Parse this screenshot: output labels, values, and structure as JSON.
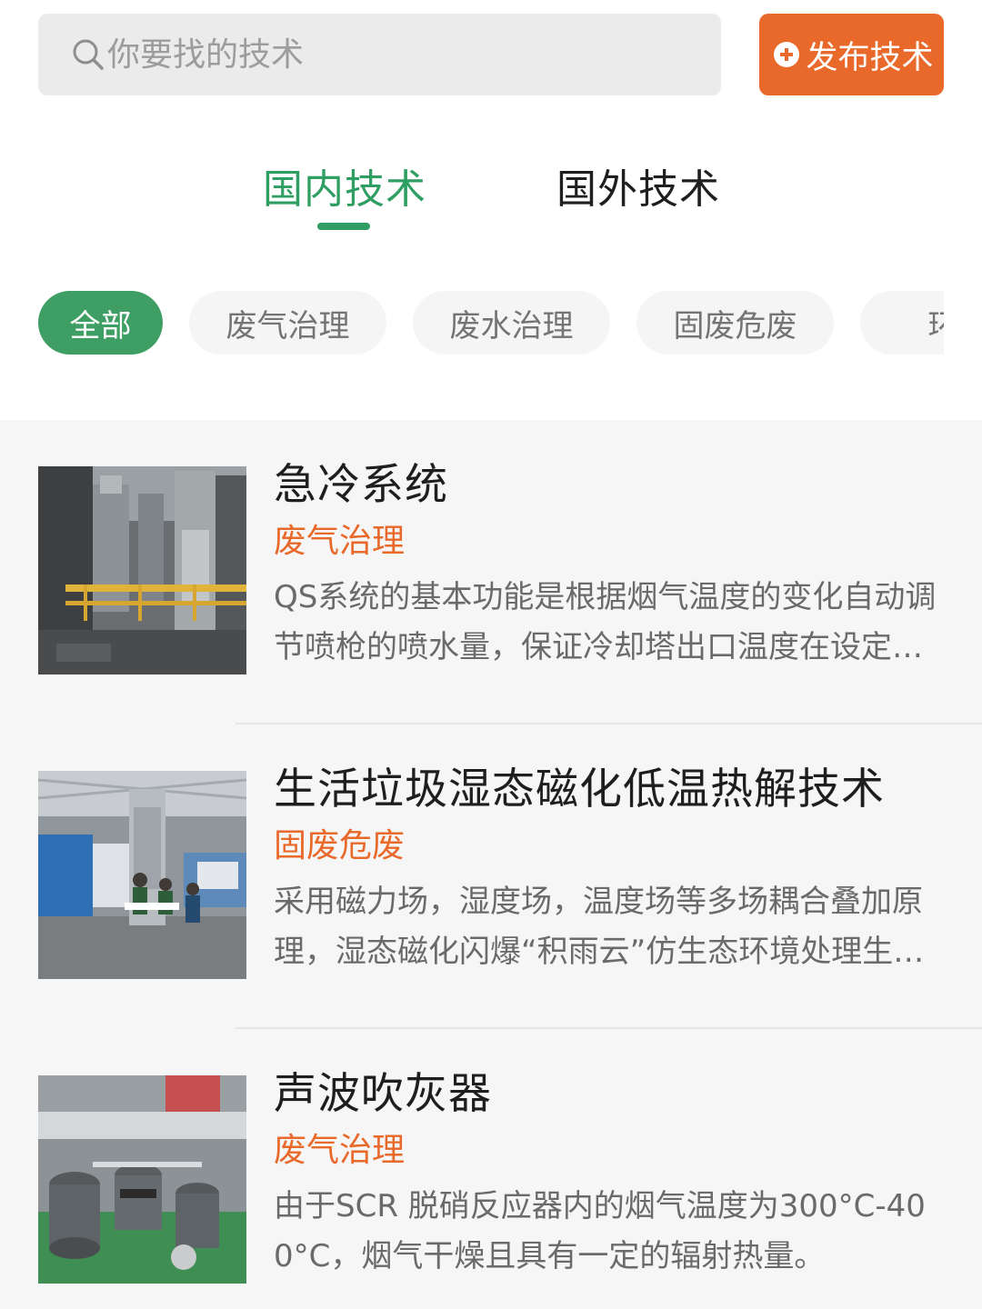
{
  "search": {
    "placeholder": "你要找的技术",
    "icon": "search-icon"
  },
  "publish": {
    "label": "发布技术",
    "icon": "plus-circle-icon",
    "color": "#e8692a"
  },
  "tabs": [
    {
      "label": "国内技术",
      "active": true
    },
    {
      "label": "国外技术",
      "active": false
    }
  ],
  "accent_color": "#2f9e62",
  "categories": [
    {
      "label": "全部",
      "active": true
    },
    {
      "label": "废气治理",
      "active": false
    },
    {
      "label": "废水治理",
      "active": false
    },
    {
      "label": "固废危废",
      "active": false
    },
    {
      "label": "环境",
      "active": false
    }
  ],
  "items": [
    {
      "title": "急冷系统",
      "category": "废气治理",
      "description": "QS系统的基本功能是根据烟气温度的变化自动调节喷枪的喷水量，保证冷却塔出口温度在设定范围内。",
      "image": "industrial-plant-photo"
    },
    {
      "title": "生活垃圾湿态磁化低温热解技术",
      "category": "固废危废",
      "description": "采用磁力场，湿度场，温度场等多场耦合叠加原理，湿态磁化闪爆“积雨云”仿生态环境处理生活垃圾。",
      "image": "exhibition-booth-photo"
    },
    {
      "title": "声波吹灰器",
      "category": "废气治理",
      "description": "由于SCR 脱硝反应器内的烟气温度为300°C-400°C，烟气干燥且具有一定的辐射热量。",
      "image": "sonic-horn-product-photo"
    }
  ]
}
